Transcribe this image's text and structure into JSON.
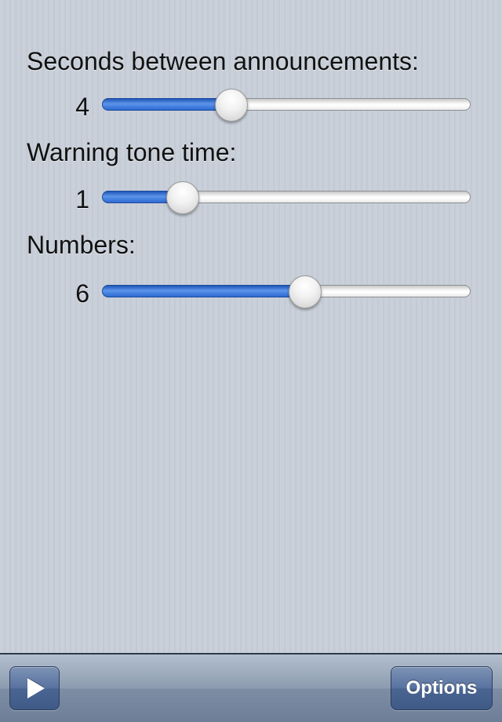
{
  "settings": [
    {
      "label": "Seconds between announcements:",
      "value": "4",
      "slider_fraction": 0.35
    },
    {
      "label": "Warning tone time:",
      "value": "1",
      "slider_fraction": 0.22
    },
    {
      "label": "Numbers:",
      "value": "6",
      "slider_fraction": 0.55
    }
  ],
  "toolbar": {
    "play_icon": "play-icon",
    "options_label": "Options"
  },
  "colors": {
    "accent_fill": "#4c88e4",
    "toolbar": "#7d8da4"
  }
}
